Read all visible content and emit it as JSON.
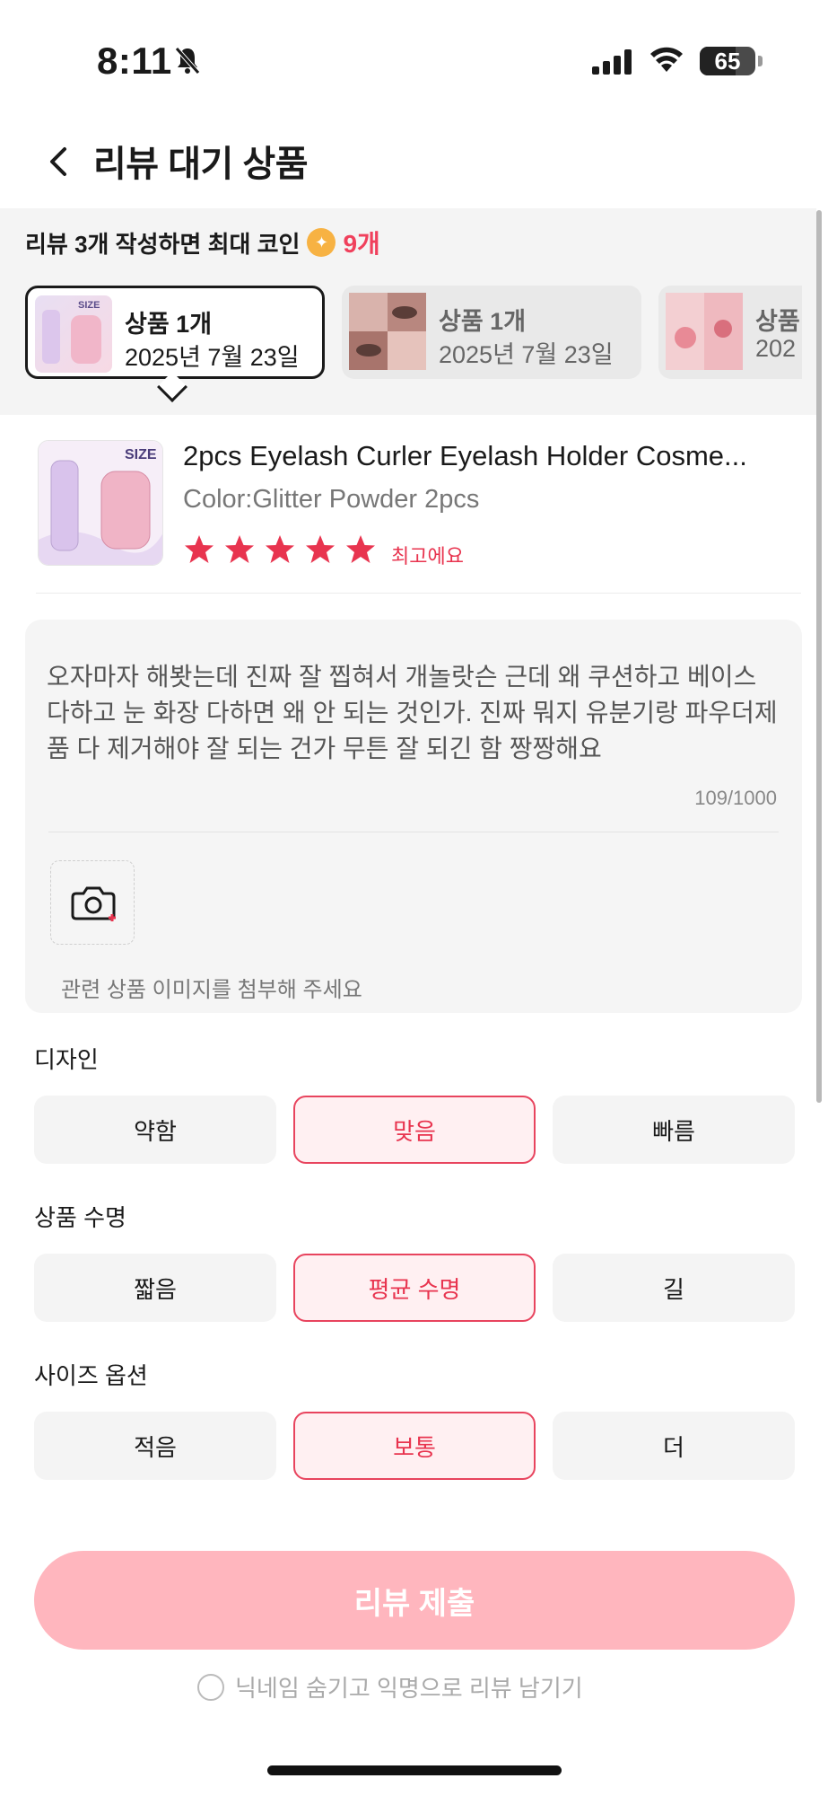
{
  "status_bar": {
    "time": "8:11",
    "battery": "65",
    "battery_level": 0.65
  },
  "header": {
    "title": "리뷰 대기 상품"
  },
  "promo": {
    "text": "리뷰 3개 작성하면 최대 코인",
    "count": "9개"
  },
  "product_tabs": [
    {
      "title": "상품 1개",
      "date": "2025년 7월 23일"
    },
    {
      "title": "상품 1개",
      "date": "2025년 7월 23일"
    },
    {
      "title": "상품",
      "date": "202"
    }
  ],
  "product": {
    "name": "2pcs Eyelash Curler Eyelash Holder Cosme...",
    "option": "Color:Glitter Powder 2pcs",
    "rating": 5,
    "rating_label": "최고에요",
    "image_text": "SIZE"
  },
  "review": {
    "text": "오자마자 해봣는데 진짜 잘 찝혀서 개놀랏슨 근데 왜 쿠션하고 베이스 다하고 눈 화장 다하면 왜 안 되는 것인가. 진짜 뭐지 유분기랑 파우더제품 다 제거해야 잘 되는 건가 무튼 잘 되긴 함 짱짱해요",
    "char_count": "109/1000",
    "photo_hint": "관련 상품 이미지를 첨부해 주세요"
  },
  "options": [
    {
      "label": "디자인",
      "choices": [
        "약함",
        "맞음",
        "빠름"
      ],
      "selected": 1
    },
    {
      "label": "상품 수명",
      "choices": [
        "짧음",
        "평균 수명",
        "길"
      ],
      "selected": 1
    },
    {
      "label": "사이즈 옵션",
      "choices": [
        "적음",
        "보통",
        "더"
      ],
      "selected": 1
    }
  ],
  "submit": {
    "label": "리뷰 제출"
  },
  "anonymous": {
    "label": "닉네임 숨기고 익명으로 리뷰 남기기"
  },
  "colors": {
    "accent": "#e8344f",
    "submit_bg": "#ffb6be",
    "coin": "#f7b243"
  }
}
